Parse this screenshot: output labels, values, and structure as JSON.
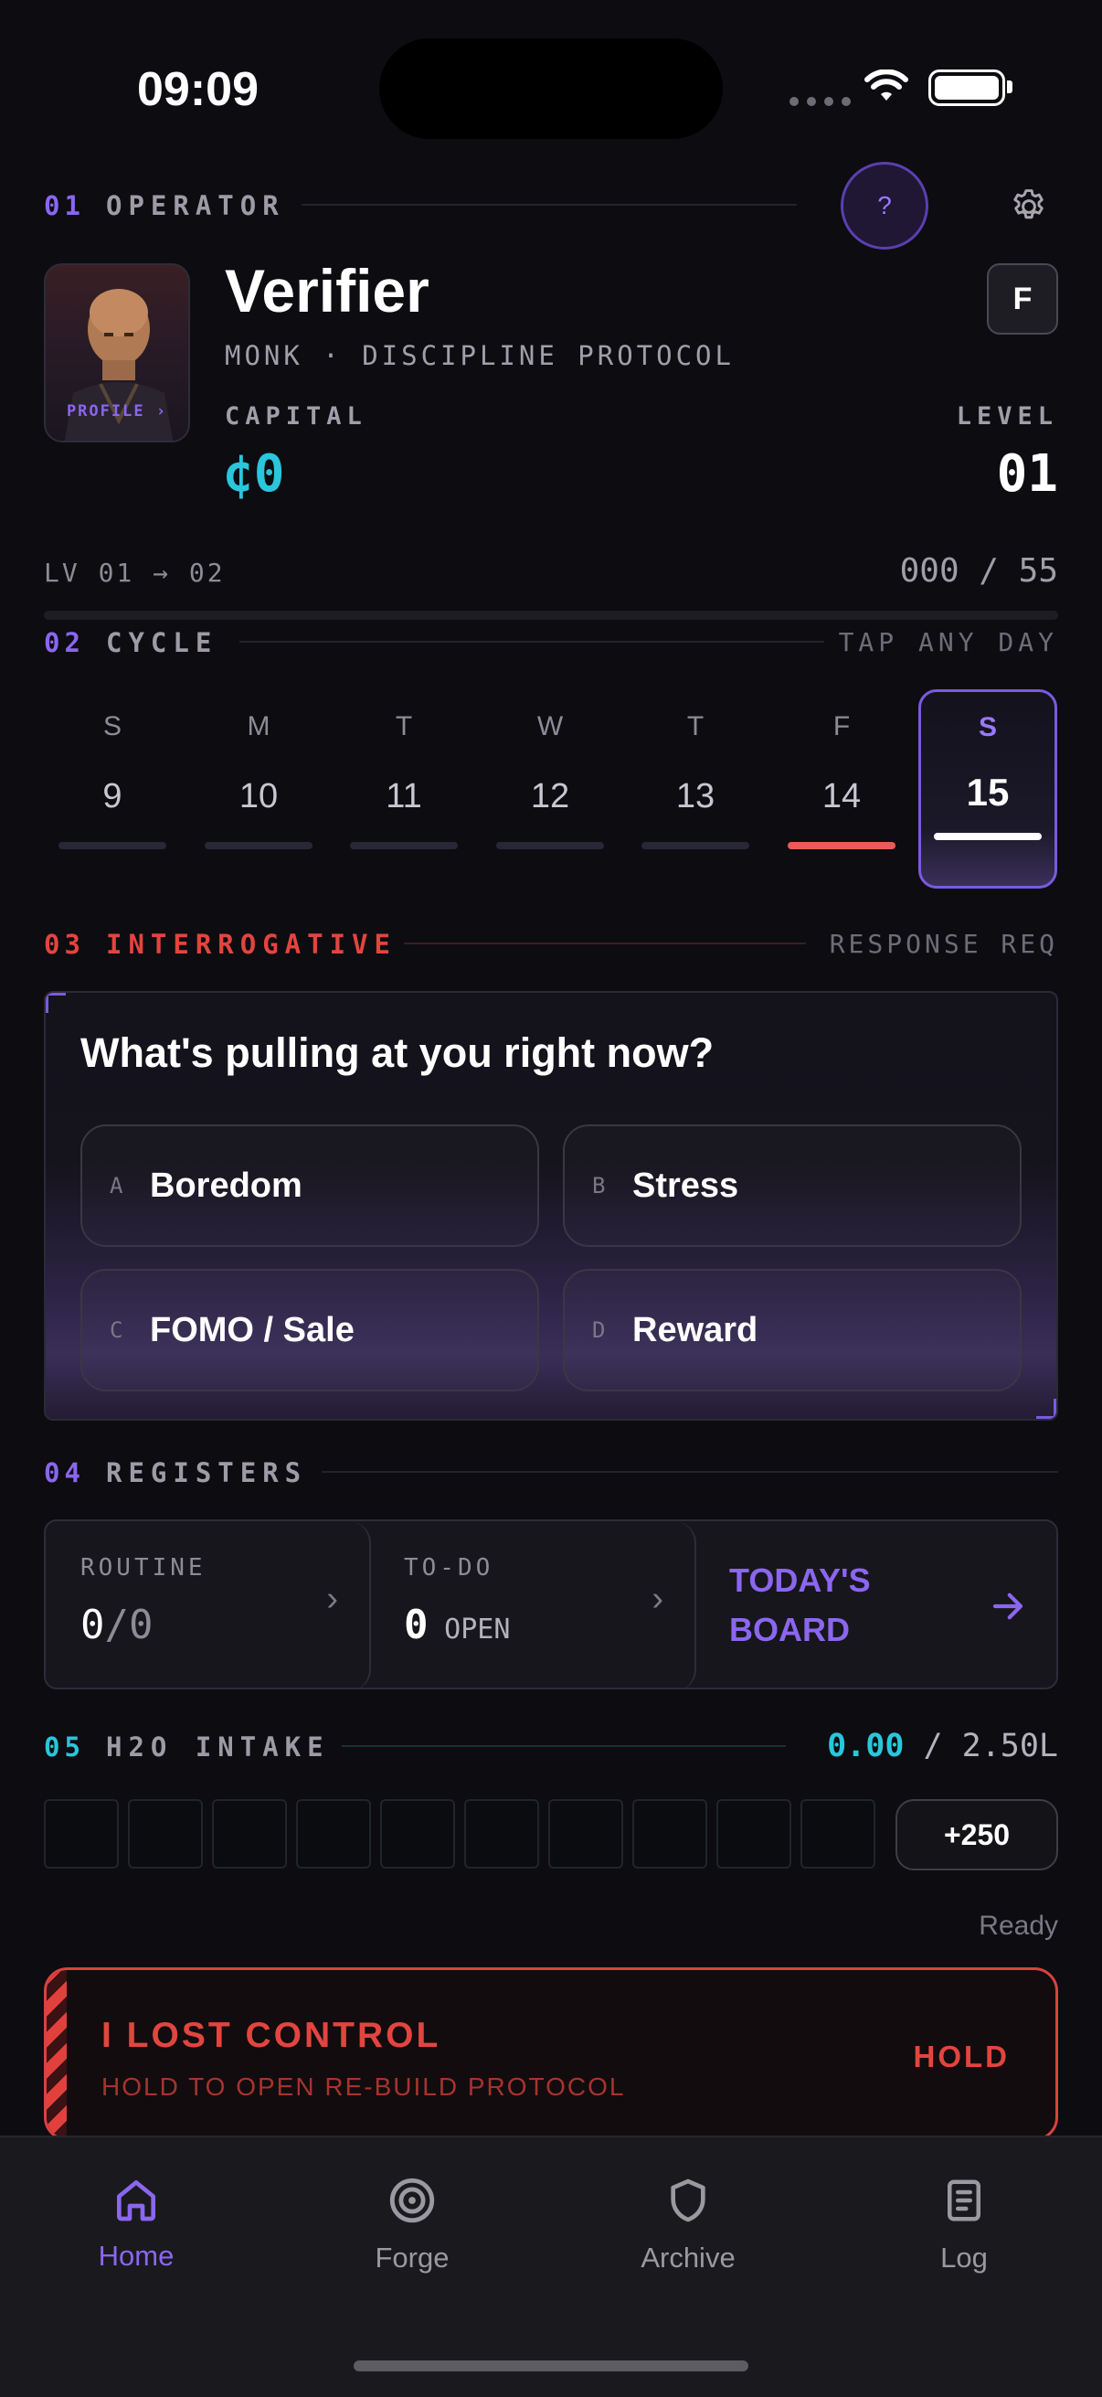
{
  "status_bar": {
    "time": "09:09"
  },
  "operator": {
    "section_num": "01",
    "section_title": "OPERATOR",
    "help_label": "?",
    "avatar_label": "PROFILE ›",
    "name": "Verifier",
    "subtitle": "MONK · DISCIPLINE PROTOCOL",
    "badge": "F",
    "capital_label": "CAPITAL",
    "capital_value": "¢0",
    "level_label": "LEVEL",
    "level_value": "01",
    "progress_label": "LV 01 → 02",
    "progress_value": "000 / 55",
    "progress_fraction": 0
  },
  "cycle": {
    "section_num": "02",
    "section_title": "CYCLE",
    "hint": "TAP ANY DAY",
    "days": [
      {
        "letter": "S",
        "num": "9"
      },
      {
        "letter": "M",
        "num": "10"
      },
      {
        "letter": "T",
        "num": "11"
      },
      {
        "letter": "W",
        "num": "12"
      },
      {
        "letter": "T",
        "num": "13"
      },
      {
        "letter": "F",
        "num": "14"
      },
      {
        "letter": "S",
        "num": "15"
      }
    ]
  },
  "interrogative": {
    "section_num": "03",
    "section_title": "INTERROGATIVE",
    "hint": "RESPONSE REQ",
    "question": "What's pulling at you right now?",
    "options": [
      {
        "key": "A",
        "label": "Boredom"
      },
      {
        "key": "B",
        "label": "Stress"
      },
      {
        "key": "C",
        "label": "FOMO / Sale"
      },
      {
        "key": "D",
        "label": "Reward"
      }
    ]
  },
  "registers": {
    "section_num": "04",
    "section_title": "REGISTERS",
    "routine_label": "ROUTINE",
    "routine_done": "0",
    "routine_total": "/0",
    "todo_label": "TO-DO",
    "todo_count": "0",
    "todo_suffix": "OPEN",
    "board_line1": "TODAY'S",
    "board_line2": "BOARD"
  },
  "water": {
    "section_num": "05",
    "section_title": "H2O INTAKE",
    "current": "0.00",
    "target": "/ 2.50L",
    "add_label": "+250",
    "status": "Ready",
    "filled_cups": 0,
    "total_cups": 10
  },
  "lost_control": {
    "title": "I LOST CONTROL",
    "subtitle": "HOLD TO OPEN RE-BUILD PROTOCOL",
    "action": "HOLD"
  },
  "tabs": [
    {
      "label": "Home",
      "icon": "home-icon"
    },
    {
      "label": "Forge",
      "icon": "target-icon"
    },
    {
      "label": "Archive",
      "icon": "shield-icon"
    },
    {
      "label": "Log",
      "icon": "document-icon"
    }
  ],
  "colors": {
    "accent_purple": "#8b66f0",
    "accent_cyan": "#29c6dc",
    "alert_red": "#e2453f"
  }
}
